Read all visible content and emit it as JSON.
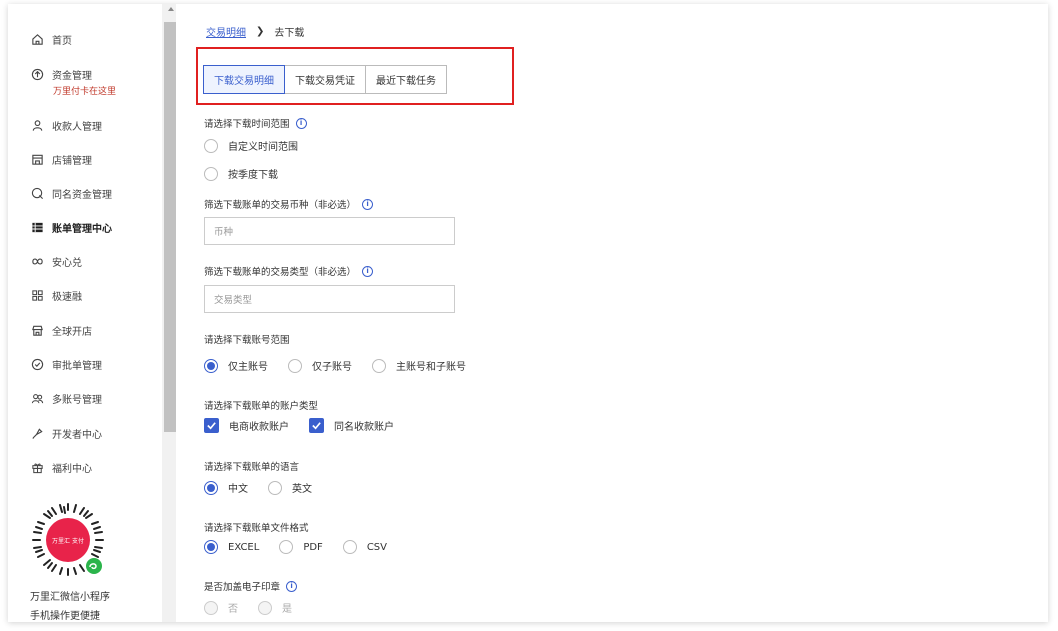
{
  "sidebar": {
    "items": [
      {
        "label": "首页",
        "icon": "home-icon"
      },
      {
        "label": "资金管理",
        "icon": "fund-icon",
        "sub": "万里付卡在这里"
      },
      {
        "label": "收款人管理",
        "icon": "payee-icon"
      },
      {
        "label": "店铺管理",
        "icon": "shop-icon"
      },
      {
        "label": "同名资金管理",
        "icon": "same-name-fund-icon"
      },
      {
        "label": "账单管理中心",
        "icon": "bill-icon"
      },
      {
        "label": "安心兑",
        "icon": "exchange-icon"
      },
      {
        "label": "极速融",
        "icon": "finance-icon"
      },
      {
        "label": "全球开店",
        "icon": "global-store-icon"
      },
      {
        "label": "审批单管理",
        "icon": "approval-icon"
      },
      {
        "label": "多账号管理",
        "icon": "multi-account-icon"
      },
      {
        "label": "开发者中心",
        "icon": "developer-icon"
      },
      {
        "label": "福利中心",
        "icon": "gift-icon"
      }
    ],
    "qr_logo_text": "万里汇 支付",
    "mini_program_line1": "万里汇微信小程序",
    "mini_program_line2": "手机操作更便捷"
  },
  "breadcrumb": {
    "link": "交易明细",
    "separator": "❯",
    "current": "去下载"
  },
  "tabs": [
    "下载交易明细",
    "下载交易凭证",
    "最近下载任务"
  ],
  "form": {
    "time_range_label": "请选择下载时间范围",
    "time_range_options": [
      "自定义时间范围",
      "按季度下载"
    ],
    "currency_label": "筛选下载账单的交易币种（非必选）",
    "currency_placeholder": "币种",
    "tx_type_label": "筛选下载账单的交易类型（非必选）",
    "tx_type_placeholder": "交易类型",
    "account_scope_label": "请选择下载账号范围",
    "account_scope_options": [
      "仅主账号",
      "仅子账号",
      "主账号和子账号"
    ],
    "account_type_label": "请选择下载账单的账户类型",
    "account_type_options": [
      "电商收款账户",
      "同名收款账户"
    ],
    "language_label": "请选择下载账单的语言",
    "language_options": [
      "中文",
      "英文"
    ],
    "format_label": "请选择下载账单文件格式",
    "format_options": [
      "EXCEL",
      "PDF",
      "CSV"
    ],
    "stamp_label": "是否加盖电子印章",
    "stamp_options": [
      "否",
      "是"
    ]
  },
  "colors": {
    "accent": "#3a5fcd",
    "highlight": "#e02020",
    "warning_text": "#c0392b"
  }
}
